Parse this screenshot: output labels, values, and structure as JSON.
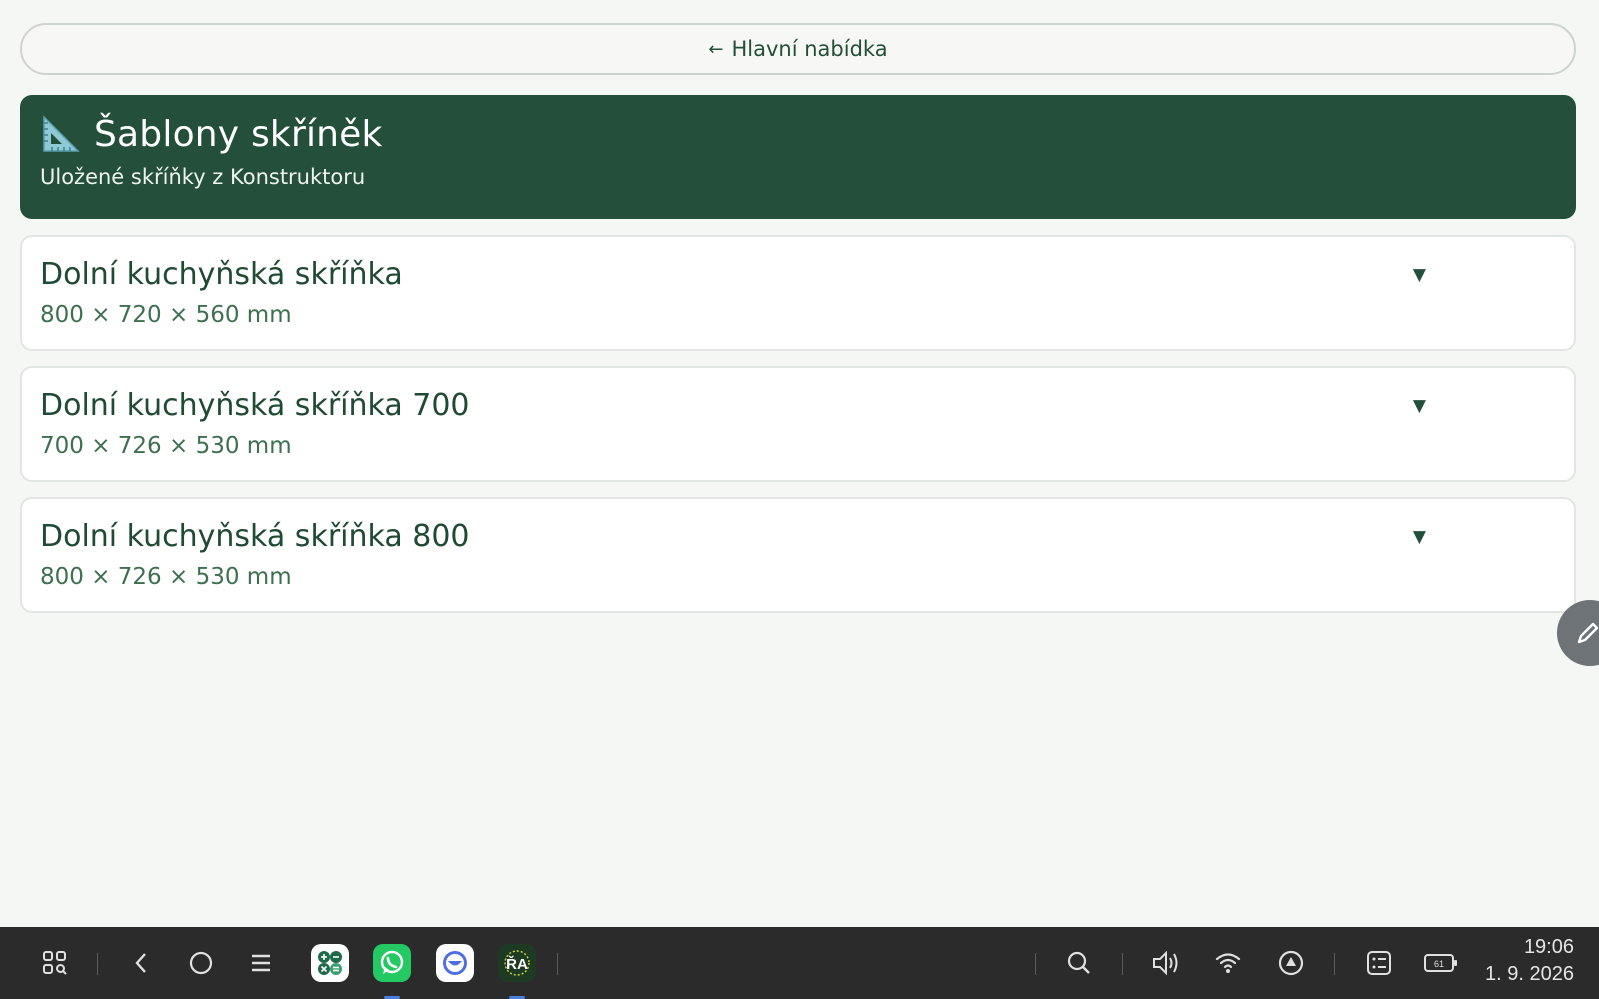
{
  "back_button": {
    "arrow": "←",
    "label": "Hlavní nabídka"
  },
  "header": {
    "icon": "triangular-ruler-icon",
    "title": "Šablony skříněk",
    "subtitle": "Uložené skříňky z Konstruktoru",
    "background": "#244f3a"
  },
  "templates": [
    {
      "name": "Dolní kuchyňská skříňka",
      "dims": "800 × 720 × 560 mm",
      "caret": "▼"
    },
    {
      "name": "Dolní kuchyňská skříňka 700",
      "dims": "700 × 726 × 530 mm",
      "caret": "▼"
    },
    {
      "name": "Dolní kuchyňská skříňka 800",
      "dims": "800 × 726 × 530 mm",
      "caret": "▼"
    }
  ],
  "fab": {
    "icon": "pencil-icon"
  },
  "taskbar": {
    "left_icons": [
      "app-grid-icon",
      "back-icon",
      "home-icon",
      "menu-icon"
    ],
    "apps": [
      "calculator-app-icon",
      "whatsapp-app-icon",
      "clock-app-icon",
      "ra-app-icon"
    ],
    "right_icons": [
      "search-icon",
      "volume-icon",
      "wifi-icon",
      "navigation-icon",
      "notes-icon",
      "battery-icon"
    ],
    "battery_level": "61",
    "time": "19:06",
    "date": "1. 9. 2026"
  }
}
